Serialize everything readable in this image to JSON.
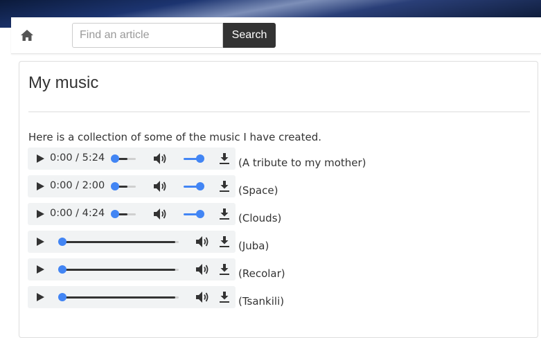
{
  "navbar": {
    "search_placeholder": "Find an article",
    "search_button_label": "Search"
  },
  "page": {
    "title": "My music",
    "intro": "Here is a collection of some of the music I have created."
  },
  "colors": {
    "accent": "#4285f4",
    "player_background": "#f1f3f4",
    "search_button": "#333333"
  },
  "tracks": [
    {
      "title": "(A tribute to my mother)",
      "time": "0:00 / 5:24",
      "progress": 0.0
    },
    {
      "title": "(Space)",
      "time": "0:00 / 2:00",
      "progress": 0.0
    },
    {
      "title": "(Clouds)",
      "time": "0:00 / 4:24",
      "progress": 0.0
    },
    {
      "title": "(Juba)",
      "time": "",
      "progress": 0.0
    },
    {
      "title": "(Recolar)",
      "time": "",
      "progress": 0.0
    },
    {
      "title": "(Tsankili)",
      "time": "",
      "progress": 0.0
    }
  ],
  "icons": {
    "home": "home-icon",
    "play": "play-icon",
    "volume": "volume-icon",
    "download": "download-icon"
  }
}
